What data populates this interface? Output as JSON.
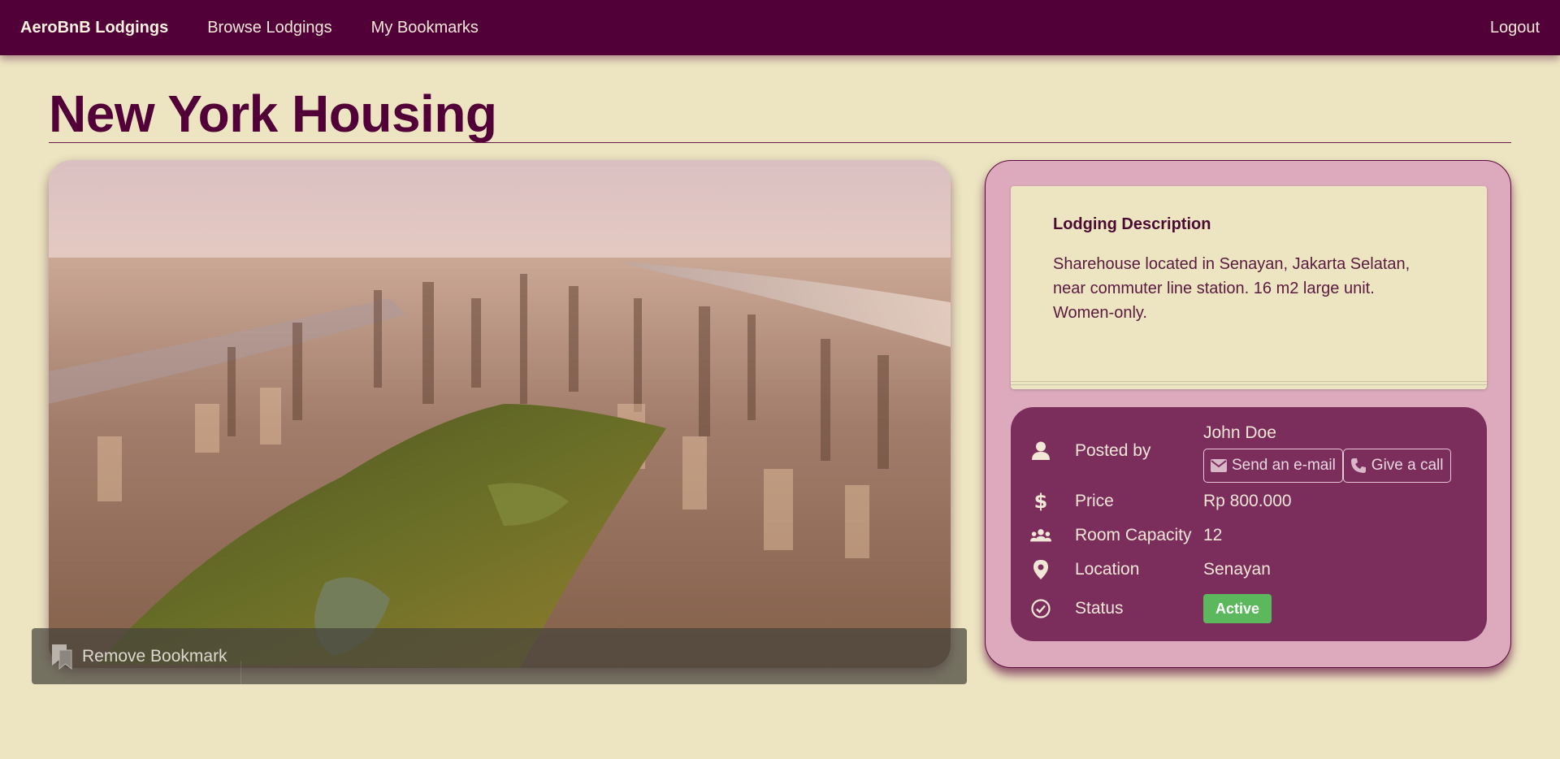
{
  "navbar": {
    "brand": "AeroBnB Lodgings",
    "links": [
      "Browse Lodgings",
      "My Bookmarks"
    ],
    "logout": "Logout"
  },
  "page": {
    "title": "New York Housing"
  },
  "image": {
    "bookmark_label": "Remove Bookmark"
  },
  "description": {
    "title": "Lodging Description",
    "text": "Sharehouse located in Senayan, Jakarta Selatan, near commuter line station. 16 m2 large unit. Women-only."
  },
  "details": {
    "posted_by_label": "Posted by",
    "poster_name": "John Doe",
    "email_button": "Send an e-mail",
    "call_button": "Give a call",
    "price_label": "Price",
    "price_value": "Rp 800.000",
    "capacity_label": "Room Capacity",
    "capacity_value": "12",
    "location_label": "Location",
    "location_value": "Senayan",
    "status_label": "Status",
    "status_value": "Active"
  },
  "icons": {
    "posted_by": "user-icon",
    "price": "dollar-icon",
    "capacity": "users-icon",
    "location": "map-marker-icon",
    "status": "check-circle-icon",
    "email": "envelope-icon",
    "call": "phone-icon",
    "bookmark": "bookmark-icon"
  },
  "colors": {
    "navbar": "#520038",
    "background": "#ede5c2",
    "panel": "#dcaabc",
    "details": "#7b2d5c",
    "status_active": "#5cb85c"
  }
}
